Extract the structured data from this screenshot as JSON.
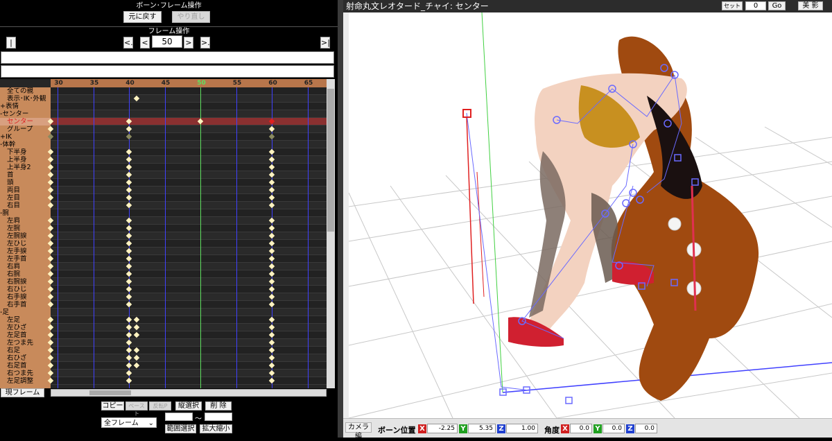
{
  "bone_panel": {
    "title": "ボーン･フレーム操作",
    "undo": "元に戻す",
    "redo": "やり直し"
  },
  "frame_panel": {
    "title": "フレーム操作",
    "first": "|<",
    "prev_key": "<.",
    "prev": "<",
    "frame": "50",
    "next": ">",
    "next_key": ">.",
    "last": ">|"
  },
  "timeline": {
    "ruler": [
      "30",
      "35",
      "40",
      "45",
      "50",
      "55",
      "60",
      "65"
    ],
    "rows": [
      "全ての親",
      "表示･IK･外観",
      "+表情",
      "-センター",
      "センター",
      "グループ",
      "+IK",
      "-体幹",
      "下半身",
      "上半身",
      "上半身2",
      "首",
      "頭",
      "両目",
      "左目",
      "右目",
      "-腕",
      "左肩",
      "左腕",
      "左腕捩",
      "左ひじ",
      "左手捩",
      "左手首",
      "右肩",
      "右腕",
      "右腕捩",
      "右ひじ",
      "右手捩",
      "右手首",
      "-足",
      "左足",
      "左ひざ",
      "左足首",
      "左つま先",
      "右足",
      "右ひざ",
      "右足首",
      "右つま先",
      "左足調整"
    ]
  },
  "bottom_left": {
    "current_frame": "現フレーム",
    "copy": "コピー",
    "paste": "ペースト",
    "reverse_paste": "反転P",
    "vertical_select": "縦選択",
    "delete": "削 除",
    "range_select": "範囲選択",
    "zoom": "拡大縮小",
    "all_frames": "全フレーム",
    "tilde": "～"
  },
  "right_header": {
    "title": "射命丸文レオタード_チャイ: センター",
    "set": "セット",
    "set_value": "0",
    "go": "Go",
    "beauty": "美 影"
  },
  "bottom_bar": {
    "camera": "カメラ編",
    "bone_pos": "ボーン位置",
    "angle": "角度",
    "x": "X",
    "y": "Y",
    "z": "Z",
    "pos_x": "-2.25",
    "pos_y": "5.35",
    "pos_z": "1.00",
    "ang_x": "0.0",
    "ang_y": "0.0",
    "ang_z": "0.0"
  },
  "colors": {
    "accent_red": "#e02020",
    "selected_row": "#8a3030",
    "frame_line": "#5fe05f",
    "blue_line": "#4040ff"
  }
}
